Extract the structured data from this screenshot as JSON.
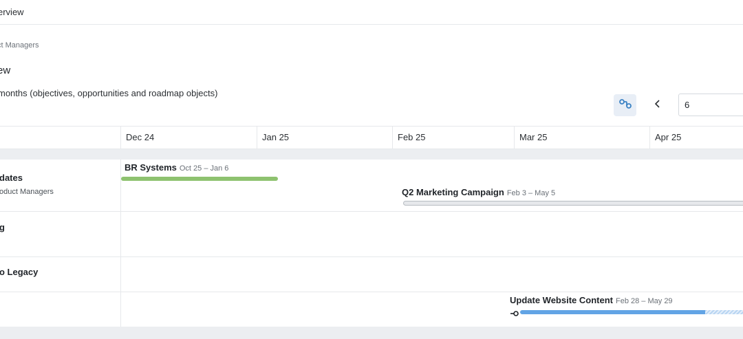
{
  "breadcrumb": {
    "text": "erview"
  },
  "header": {
    "sub_breadcrumb": "ct Managers",
    "title": "ew",
    "description": "months (objectives, opportunities and roadmap objects)"
  },
  "controls": {
    "link_icon": "link-dependencies-icon",
    "prev_icon": "chevron-left-icon",
    "months_value": "6"
  },
  "timeline": {
    "months": [
      "Dec 24",
      "Jan 25",
      "Feb 25",
      "Mar 25",
      "Apr 25"
    ]
  },
  "lanes": [
    {
      "title": "dates",
      "subtitle": "oduct Managers"
    },
    {
      "title": "g",
      "subtitle": ""
    },
    {
      "title": "o Legacy",
      "subtitle": ""
    },
    {
      "title": "",
      "subtitle": ""
    }
  ],
  "bars": [
    {
      "name": "BR Systems",
      "dates": "Oct 25 – Jan 6",
      "color": "#8ec26f"
    },
    {
      "name": "Q2 Marketing Campaign",
      "dates": "Feb 3 – May 5",
      "color": "#e6e8eb"
    },
    {
      "name": "Update Website Content",
      "dates": "Feb 28 – May 29",
      "color": "#62a4e5",
      "icon": "dependency-link-icon"
    }
  ]
}
